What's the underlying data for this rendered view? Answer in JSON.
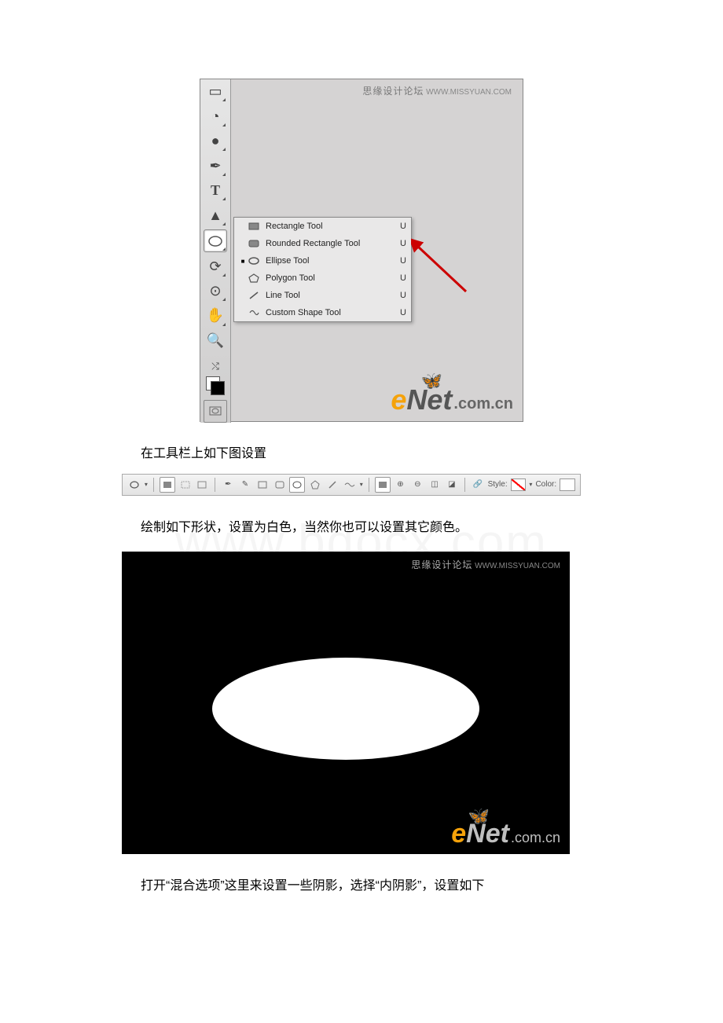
{
  "watermark_site": {
    "cn": "思缘设计论坛",
    "en": "WWW.MISSYUAN.COM"
  },
  "enet": {
    "e": "e",
    "net": "Net",
    "domain": ".com.cn"
  },
  "doc_watermark": "www.bdocx.com",
  "toolbar": {
    "tools": [
      {
        "name": "gradient"
      },
      {
        "name": "blur"
      },
      {
        "name": "dodge"
      },
      {
        "name": "pen"
      },
      {
        "name": "type"
      },
      {
        "name": "path-select"
      },
      {
        "name": "shape"
      },
      {
        "name": "3d-rotate"
      },
      {
        "name": "3d-orbit"
      },
      {
        "name": "hand"
      },
      {
        "name": "zoom"
      }
    ]
  },
  "flyout": {
    "items": [
      {
        "label": "Rectangle Tool",
        "key": "U",
        "active": false,
        "shape": "rect"
      },
      {
        "label": "Rounded Rectangle Tool",
        "key": "U",
        "active": false,
        "shape": "roundrect"
      },
      {
        "label": "Ellipse Tool",
        "key": "U",
        "active": true,
        "shape": "ellipse"
      },
      {
        "label": "Polygon Tool",
        "key": "U",
        "active": false,
        "shape": "polygon"
      },
      {
        "label": "Line Tool",
        "key": "U",
        "active": false,
        "shape": "line"
      },
      {
        "label": "Custom Shape Tool",
        "key": "U",
        "active": false,
        "shape": "custom"
      }
    ]
  },
  "captions": {
    "c1": "在工具栏上如下图设置",
    "c2": "绘制如下形状，设置为白色，当然你也可以设置其它颜色。",
    "c3": "打开“混合选项”这里来设置一些阴影，选择“内阴影”，设置如下"
  },
  "optbar": {
    "style_label": "Style:",
    "color_label": "Color:"
  }
}
